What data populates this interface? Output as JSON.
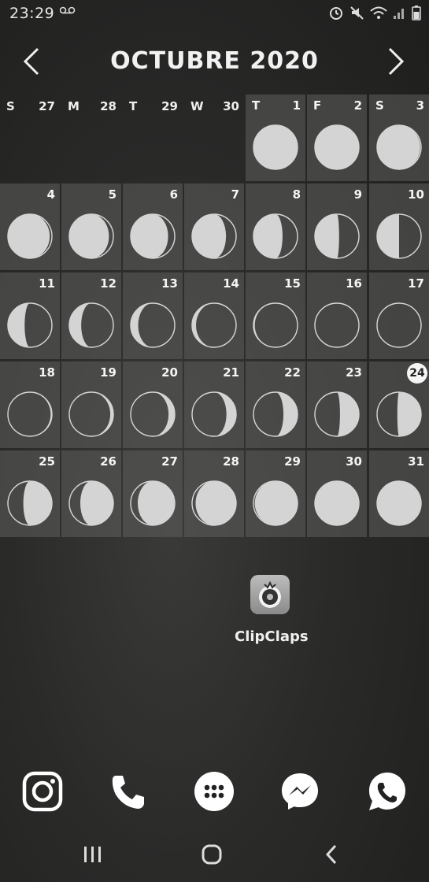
{
  "status_bar": {
    "time": "23:29",
    "icons": [
      "voicemail-icon",
      "alarm-icon",
      "mute-icon",
      "wifi-icon",
      "signal-icon",
      "battery-icon"
    ]
  },
  "calendar": {
    "title": "OCTUBRE 2020",
    "weekday_header": [
      {
        "wd": "S",
        "num": "27"
      },
      {
        "wd": "M",
        "num": "28"
      },
      {
        "wd": "T",
        "num": "29"
      },
      {
        "wd": "W",
        "num": "30"
      }
    ],
    "first_row": [
      {
        "wd": "T",
        "num": "1"
      },
      {
        "wd": "F",
        "num": "2"
      },
      {
        "wd": "S",
        "num": "3"
      }
    ],
    "days": [
      "4",
      "5",
      "6",
      "7",
      "8",
      "9",
      "10",
      "11",
      "12",
      "13",
      "14",
      "15",
      "16",
      "17",
      "18",
      "19",
      "20",
      "21",
      "22",
      "23",
      "24",
      "25",
      "26",
      "27",
      "28",
      "29",
      "30",
      "31"
    ],
    "today": "24"
  },
  "app": {
    "label": "ClipClaps"
  },
  "dock": [
    "instagram-icon",
    "phone-icon",
    "apps-icon",
    "messenger-icon",
    "whatsapp-icon"
  ],
  "nav": [
    "recents-button",
    "home-button",
    "back-button"
  ],
  "colors": {
    "cell_bg": "#5a5a58",
    "moon": "#d4d4d4"
  }
}
